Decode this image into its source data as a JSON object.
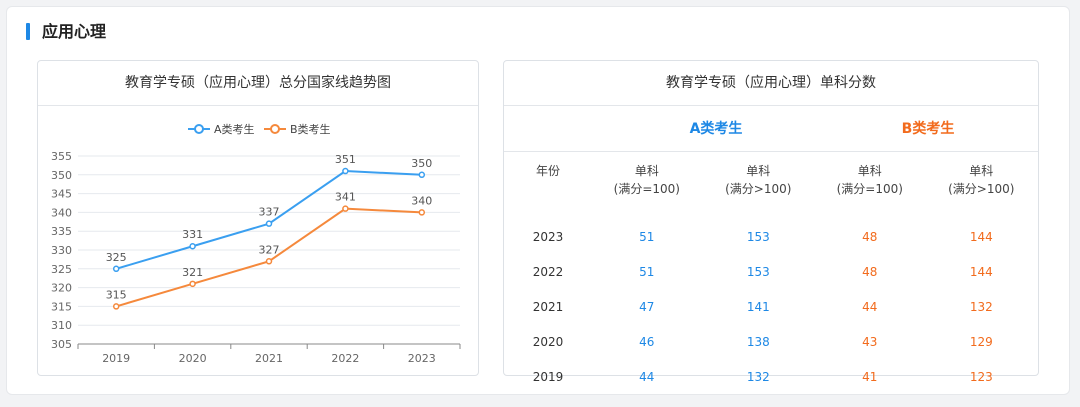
{
  "section": {
    "title": "应用心理"
  },
  "chart_data": {
    "type": "line",
    "title": "教育学专硕（应用心理）总分国家线趋势图",
    "categories": [
      "2019",
      "2020",
      "2021",
      "2022",
      "2023"
    ],
    "series": [
      {
        "name": "A类考生",
        "color": "#3a9ff0",
        "values": [
          325,
          331,
          337,
          351,
          350
        ]
      },
      {
        "name": "B类考生",
        "color": "#f5893c",
        "values": [
          315,
          321,
          327,
          341,
          340
        ]
      }
    ],
    "ylim": [
      305,
      355
    ],
    "yticks": [
      305,
      310,
      315,
      320,
      325,
      330,
      335,
      340,
      345,
      350,
      355
    ],
    "grid": true,
    "legend": "top-center"
  },
  "table": {
    "title": "教育学专硕（应用心理）单科分数",
    "group_a": "A类考生",
    "group_b": "B类考生",
    "col_year": "年份",
    "col_sub": "单科",
    "col_le": "(满分=100)",
    "col_gt": "(满分>100)",
    "rows": [
      {
        "year": "2023",
        "a1": "51",
        "a2": "153",
        "b1": "48",
        "b2": "144"
      },
      {
        "year": "2022",
        "a1": "51",
        "a2": "153",
        "b1": "48",
        "b2": "144"
      },
      {
        "year": "2021",
        "a1": "47",
        "a2": "141",
        "b1": "44",
        "b2": "132"
      },
      {
        "year": "2020",
        "a1": "46",
        "a2": "138",
        "b1": "43",
        "b2": "129"
      },
      {
        "year": "2019",
        "a1": "44",
        "a2": "132",
        "b1": "41",
        "b2": "123"
      }
    ]
  }
}
